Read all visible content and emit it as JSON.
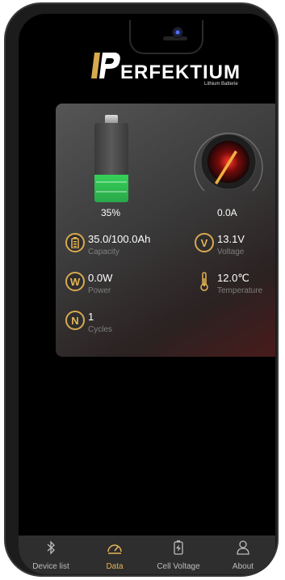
{
  "brand": {
    "name": "ERFEKTIUM",
    "subtitle": "Lithium Batterie"
  },
  "battery": {
    "level_percent": 35,
    "label": "35%"
  },
  "current": {
    "label": "0.0A"
  },
  "metrics": [
    {
      "value": "35.0/100.0Ah",
      "label": "Capacity",
      "icon": "battery-capacity-icon"
    },
    {
      "value": "13.1V",
      "label": "Voltage",
      "icon": "voltage-icon"
    },
    {
      "value": "0.0W",
      "label": "Power",
      "icon": "power-icon"
    },
    {
      "value": "12.0℃",
      "label": "Temperature",
      "icon": "thermometer-icon"
    },
    {
      "value": "1",
      "label": "Cycles",
      "icon": "cycles-icon"
    }
  ],
  "icon_letters": {
    "voltage": "V",
    "power": "W",
    "cycles": "N"
  },
  "nav": [
    {
      "label": "Device list",
      "icon": "bluetooth-icon",
      "active": false
    },
    {
      "label": "Data",
      "icon": "gauge-icon",
      "active": true
    },
    {
      "label": "Cell Voltage",
      "icon": "battery-charge-icon",
      "active": false
    },
    {
      "label": "About",
      "icon": "user-icon",
      "active": false
    }
  ],
  "colors": {
    "accent": "#e5b456",
    "battery_green": "#34d058",
    "nav_bg": "#2e2e2e",
    "screen_bg": "#000000"
  }
}
